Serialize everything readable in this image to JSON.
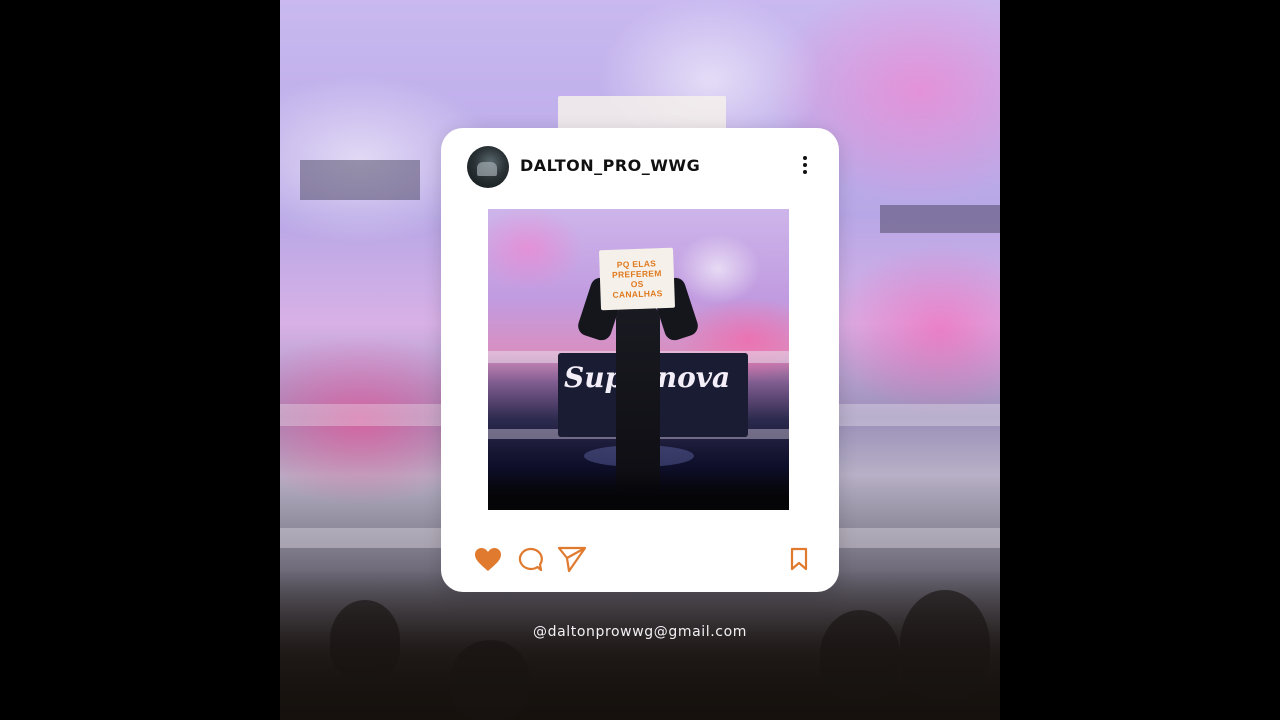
{
  "post": {
    "username": "DALTON_PRO_WWG",
    "photo": {
      "placard_lines": [
        "PQ ELAS",
        "PREFEREM",
        "OS",
        "CANALHAS"
      ],
      "banner_text": "Supernova"
    },
    "actions": {
      "like": "heart-icon",
      "comment": "comment-bubble-icon",
      "share": "send-icon",
      "save": "bookmark-icon",
      "more": "more-vertical-icon"
    }
  },
  "contact": {
    "email": "@daltonprowwg@gmail.com"
  },
  "colors": {
    "accent": "#e07a2f",
    "card": "#ffffff",
    "text": "#111111"
  }
}
